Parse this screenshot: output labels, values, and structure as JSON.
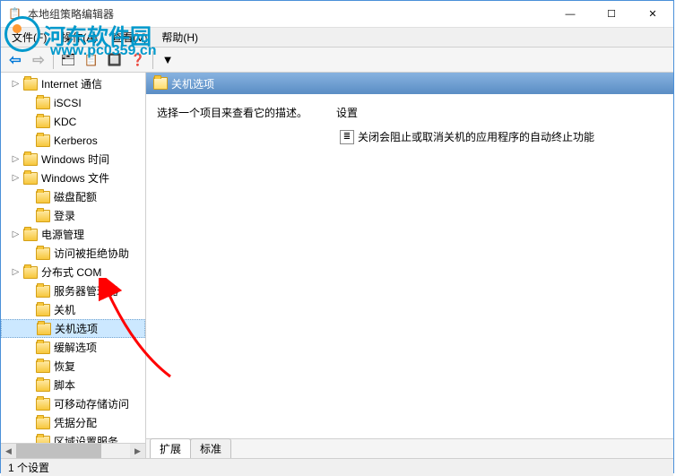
{
  "window": {
    "title": "本地组策略编辑器"
  },
  "menubar": {
    "file": "文件(F)",
    "action": "操作(A)",
    "view": "查看(V)",
    "help": "帮助(H)"
  },
  "tree": {
    "items": [
      {
        "label": "Internet 通信",
        "expandable": true,
        "indent": 1
      },
      {
        "label": "iSCSI",
        "expandable": false,
        "indent": 2
      },
      {
        "label": "KDC",
        "expandable": false,
        "indent": 2
      },
      {
        "label": "Kerberos",
        "expandable": false,
        "indent": 2
      },
      {
        "label": "Windows 时间",
        "expandable": true,
        "indent": 1
      },
      {
        "label": "Windows 文件",
        "expandable": true,
        "indent": 1
      },
      {
        "label": "磁盘配额",
        "expandable": false,
        "indent": 2
      },
      {
        "label": "登录",
        "expandable": false,
        "indent": 2
      },
      {
        "label": "电源管理",
        "expandable": true,
        "indent": 1
      },
      {
        "label": "访问被拒绝协助",
        "expandable": false,
        "indent": 2
      },
      {
        "label": "分布式 COM",
        "expandable": true,
        "indent": 1
      },
      {
        "label": "服务器管理器",
        "expandable": false,
        "indent": 2
      },
      {
        "label": "关机",
        "expandable": false,
        "indent": 2
      },
      {
        "label": "关机选项",
        "expandable": false,
        "indent": 2,
        "selected": true
      },
      {
        "label": "缓解选项",
        "expandable": false,
        "indent": 2
      },
      {
        "label": "恢复",
        "expandable": false,
        "indent": 2
      },
      {
        "label": "脚本",
        "expandable": false,
        "indent": 2
      },
      {
        "label": "可移动存储访问",
        "expandable": false,
        "indent": 2
      },
      {
        "label": "凭据分配",
        "expandable": false,
        "indent": 2
      },
      {
        "label": "区域设置服务",
        "expandable": false,
        "indent": 2
      }
    ]
  },
  "detail": {
    "header_title": "关机选项",
    "description_prompt": "选择一个项目来查看它的描述。",
    "settings_label": "设置",
    "setting_items": [
      {
        "label": "关闭会阻止或取消关机的应用程序的自动终止功能"
      }
    ]
  },
  "tabs": {
    "extended": "扩展",
    "standard": "标准"
  },
  "statusbar": {
    "text": "1 个设置"
  },
  "watermark": {
    "text": "河东软件园",
    "url": "www.pc0359.cn"
  },
  "win_controls": {
    "minimize": "—",
    "maximize": "☐",
    "close": "✕"
  }
}
